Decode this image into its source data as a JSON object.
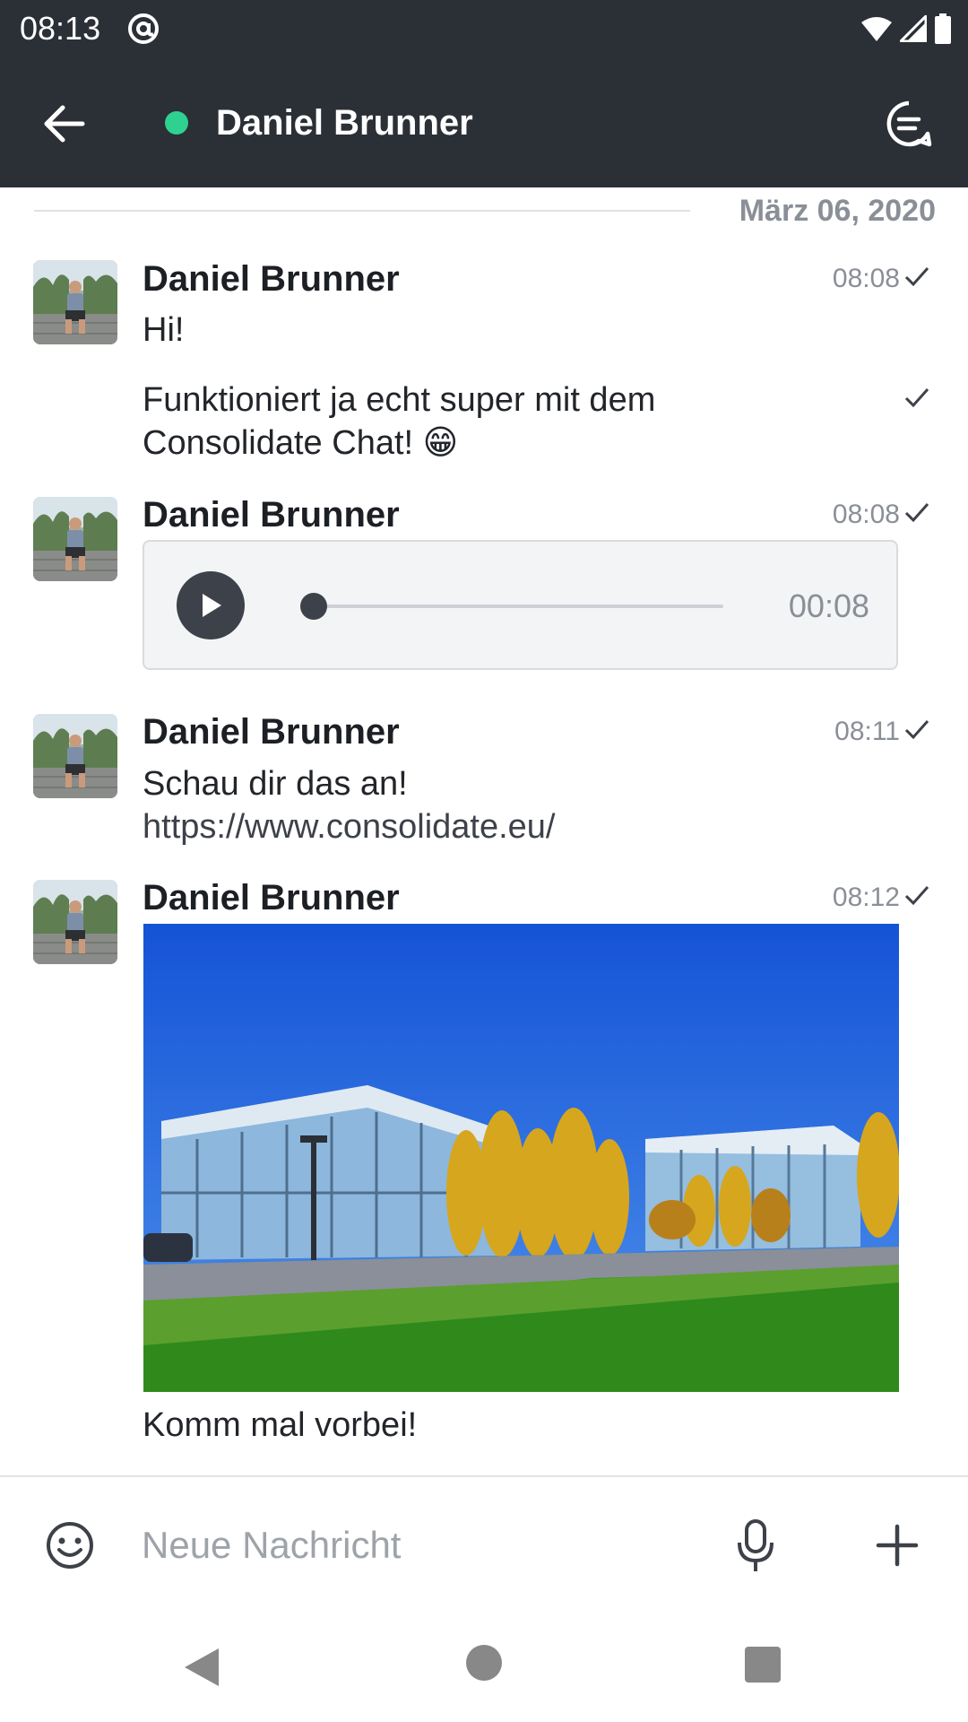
{
  "status_bar": {
    "time": "08:13",
    "icons": [
      "at-sign-icon",
      "wifi-icon",
      "signal-icon",
      "battery-icon"
    ]
  },
  "header": {
    "title": "Daniel Brunner",
    "online_status_color": "#2ed18f",
    "icons": [
      "back-arrow-icon",
      "threads-icon"
    ]
  },
  "chat": {
    "date_divider": "März 06, 2020",
    "messages": [
      {
        "sender": "Daniel Brunner",
        "time": "08:08",
        "lines": [
          "Hi!"
        ],
        "status": "sent"
      },
      {
        "sender": "",
        "time": "",
        "lines": [
          "Funktioniert ja echt super mit dem",
          "Consolidate Chat! 😁"
        ],
        "status": "sent"
      },
      {
        "sender": "Daniel Brunner",
        "time": "08:08",
        "type": "audio",
        "audio": {
          "duration": "00:08",
          "progress": 0
        },
        "status": "sent"
      },
      {
        "sender": "Daniel Brunner",
        "time": "08:11",
        "lines": [
          "Schau dir das an!"
        ],
        "link": "https://www.consolidate.eu/",
        "status": "sent"
      },
      {
        "sender": "Daniel Brunner",
        "time": "08:12",
        "type": "image",
        "caption": "Komm mal vorbei!",
        "status": "sent"
      }
    ]
  },
  "composer": {
    "placeholder": "Neue Nachricht",
    "icons": [
      "emoji-icon",
      "microphone-icon",
      "plus-icon"
    ]
  },
  "nav_bar": {
    "icons": [
      "nav-back-icon",
      "nav-home-icon",
      "nav-recents-icon"
    ]
  },
  "colors": {
    "header_bg": "#2b2f36",
    "accent_dark": "#3d4149",
    "muted_text": "#8a8f97"
  }
}
